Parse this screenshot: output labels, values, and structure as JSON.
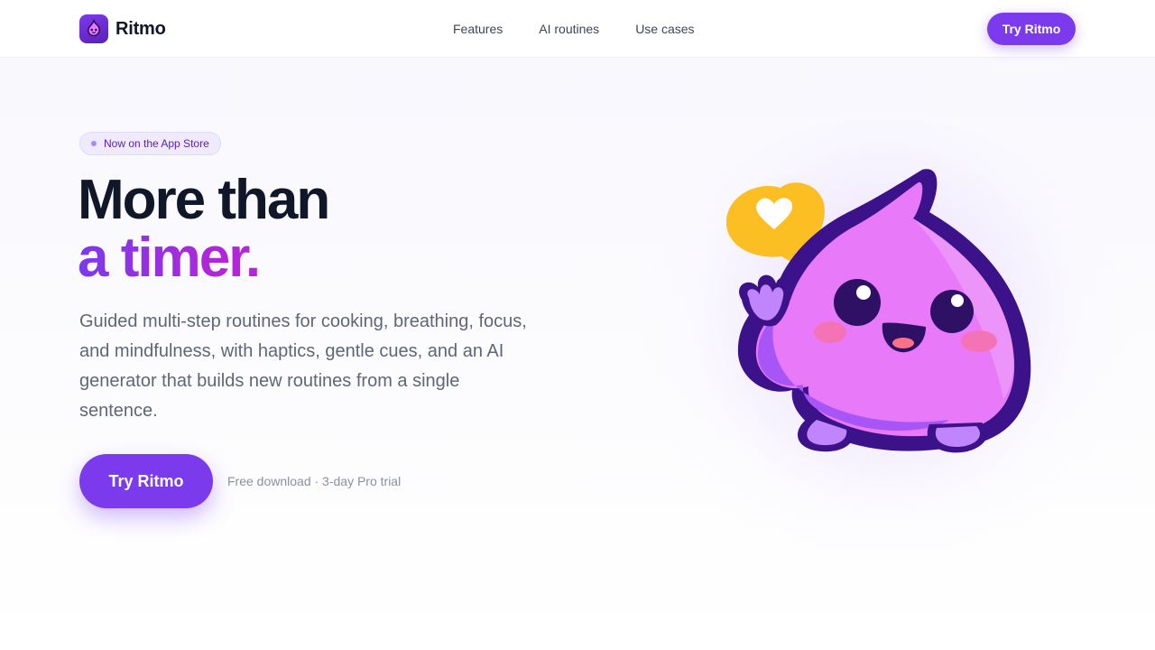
{
  "brand": {
    "name": "Ritmo",
    "logo_icon": "mascot-logo-icon",
    "accent_color": "#7c3aed"
  },
  "nav": {
    "items": [
      {
        "label": "Features"
      },
      {
        "label": "AI routines"
      },
      {
        "label": "Use cases"
      }
    ],
    "cta_label": "Try Ritmo"
  },
  "hero": {
    "badge": "Now on the App Store",
    "headline_line1": "More than",
    "headline_line2": "a timer.",
    "subtext": "Guided multi-step routines for cooking, breathing, focus, and mindfulness, with haptics, gentle cues, and an AI generator that builds new routines from a single sentence.",
    "cta_label": "Try Ritmo",
    "note": "Free download · 3-day Pro trial",
    "illustration": "ritmo-mascot-waving-with-heart-bubble",
    "colors": {
      "mascot_body": "#e879f9",
      "mascot_outline": "#3b1289",
      "heart_bubble": "#fbbf24",
      "cheeks": "#f472b6"
    }
  }
}
